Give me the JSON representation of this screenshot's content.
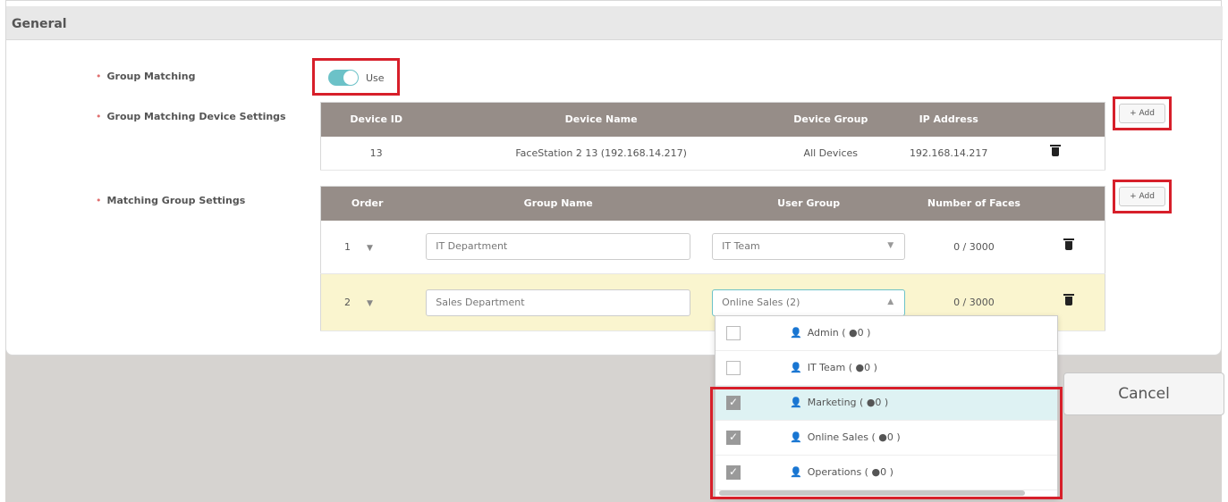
{
  "section": {
    "title": "General"
  },
  "group_matching": {
    "label": "Group Matching",
    "toggle_label": "Use",
    "enabled": true
  },
  "device_settings": {
    "label": "Group Matching Device Settings",
    "add_label": "+ Add",
    "columns": [
      "Device ID",
      "Device Name",
      "Device Group",
      "IP Address"
    ],
    "rows": [
      {
        "device_id": "13",
        "device_name": "FaceStation 2 13 (192.168.14.217)",
        "device_group": "All Devices",
        "ip_address": "192.168.14.217"
      }
    ]
  },
  "group_settings": {
    "label": "Matching Group Settings",
    "add_label": "+ Add",
    "columns": [
      "Order",
      "Group Name",
      "User Group",
      "Number of Faces"
    ],
    "rows": [
      {
        "order": "1",
        "group_name": "IT Department",
        "user_group": "IT Team",
        "faces": "0 / 3000"
      },
      {
        "order": "2",
        "group_name": "Sales Department",
        "user_group": "Online Sales (2)",
        "faces": "0 / 3000"
      }
    ]
  },
  "user_group_dropdown": {
    "items": [
      {
        "label": "Admin ( ",
        "count": "0 )",
        "checked": false
      },
      {
        "label": "IT Team ( ",
        "count": "0 )",
        "checked": false
      },
      {
        "label": "Marketing ( ",
        "count": "0 )",
        "checked": true
      },
      {
        "label": "Online Sales ( ",
        "count": "0 )",
        "checked": true
      },
      {
        "label": "Operations ( ",
        "count": "0 )",
        "checked": true
      }
    ]
  },
  "footer": {
    "cancel_label": "Cancel"
  },
  "colors": {
    "accent": "#6cc2c8",
    "highlight": "#d71f2a",
    "header": "#968d88",
    "selected_row": "#faf5cf"
  }
}
